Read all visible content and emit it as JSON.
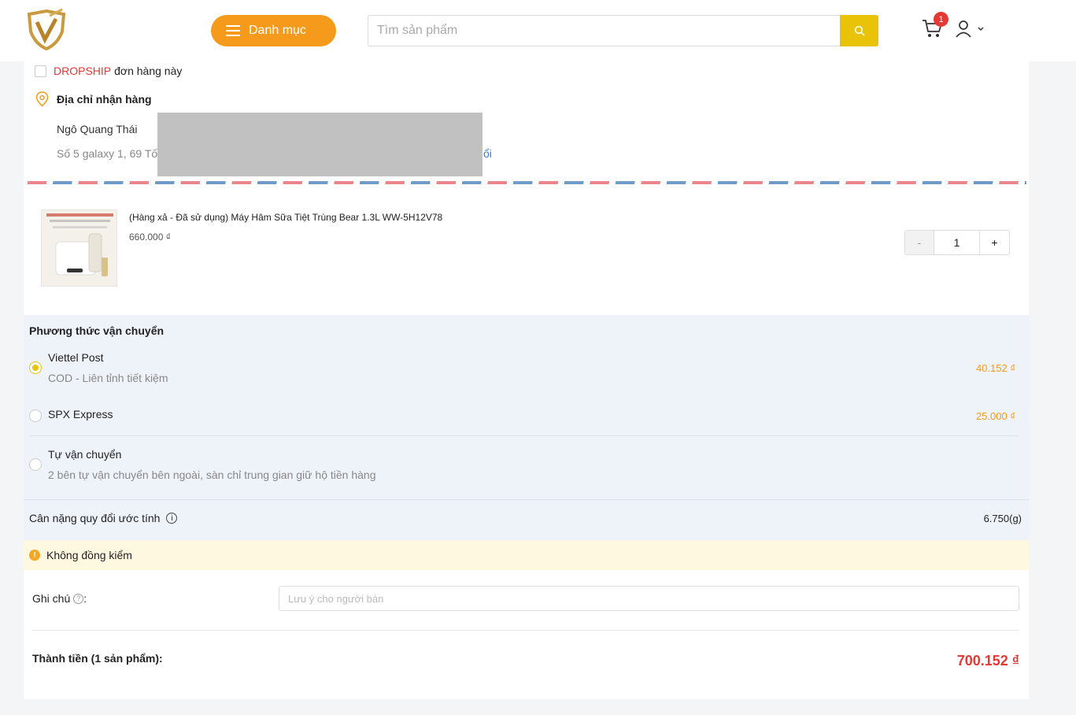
{
  "header": {
    "category_label": "Danh mục",
    "search_placeholder": "Tìm sản phẩm",
    "cart_count": "1"
  },
  "dropship": {
    "highlight": "DROPSHIP",
    "rest": "đơn hàng này"
  },
  "address": {
    "title": "Địa chỉ nhận hàng",
    "name": "Ngô Quang Thái",
    "line": "Số 5 galaxy 1, 69 Tố",
    "change_fragment": "ổi"
  },
  "product": {
    "name": "(Hàng xả - Đã sử dụng) Máy Hâm Sữa Tiệt Trùng Bear 1.3L WW-5H12V78",
    "price": "660.000 ₫",
    "quantity": "1",
    "minus": "-",
    "plus": "+"
  },
  "shipping": {
    "title": "Phương thức vận chuyển",
    "options": [
      {
        "name": "Viettel Post",
        "sub": "COD - Liên tỉnh tiết kiệm",
        "price": "40.152 ₫",
        "selected": true
      },
      {
        "name": "SPX Express",
        "sub": "",
        "price": "25.000 ₫",
        "selected": false
      },
      {
        "name": "Tự vận chuyển",
        "sub": "2 bên tự vận chuyển bên ngoài, sàn chỉ trung gian giữ hộ tiền hàng",
        "price": "",
        "selected": false
      }
    ],
    "weight_label": "Cân nặng quy đổi ước tính",
    "weight_value": "6.750(g)"
  },
  "warning": {
    "text": "Không đồng kiểm"
  },
  "note": {
    "label": "Ghi chú",
    "colon": ":",
    "placeholder": "Lưu ý cho người bán"
  },
  "total": {
    "label": "Thành tiền (1 sản phẩm):",
    "value": "700.152 ₫"
  },
  "colors": {
    "accent": "#f59a1b",
    "search_button": "#e9c308",
    "price_red": "#e53935"
  }
}
